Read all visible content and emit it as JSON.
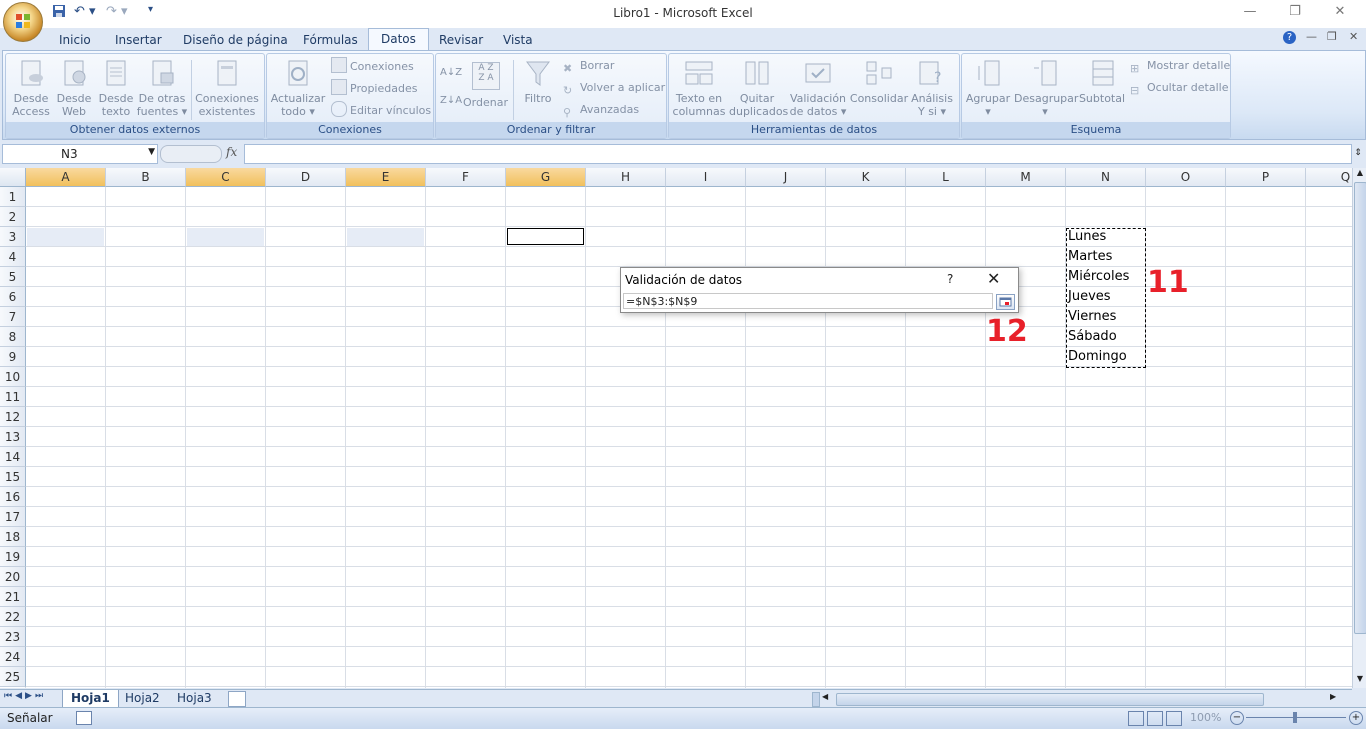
{
  "window": {
    "title": "Libro1 - Microsoft Excel",
    "controls": {
      "minimize": "—",
      "restore": "❐",
      "close": "✕"
    }
  },
  "tabs": [
    "Inicio",
    "Insertar",
    "Diseño de página",
    "Fórmulas",
    "Datos",
    "Revisar",
    "Vista"
  ],
  "active_tab": "Datos",
  "ribbon": {
    "groups": {
      "external": {
        "label": "Obtener datos externos",
        "buttons": [
          {
            "line1": "Desde",
            "line2": "Access"
          },
          {
            "line1": "Desde",
            "line2": "Web"
          },
          {
            "line1": "Desde",
            "line2": "texto"
          },
          {
            "line1": "De otras",
            "line2": "fuentes ▾"
          },
          {
            "line1": "Conexiones",
            "line2": "existentes"
          }
        ]
      },
      "connections": {
        "label": "Conexiones",
        "refresh": {
          "line1": "Actualizar",
          "line2": "todo ▾"
        },
        "items": [
          "Conexiones",
          "Propiedades",
          "Editar vínculos"
        ]
      },
      "sort": {
        "label": "Ordenar y filtrar",
        "sort_btn": "Ordenar",
        "filter_btn": "Filtro",
        "items": [
          "Borrar",
          "Volver a aplicar",
          "Avanzadas"
        ]
      },
      "tools": {
        "label": "Herramientas de datos",
        "buttons": [
          {
            "line1": "Texto en",
            "line2": "columnas"
          },
          {
            "line1": "Quitar",
            "line2": "duplicados"
          },
          {
            "line1": "Validación",
            "line2": "de datos ▾"
          },
          {
            "line1": "Consolidar",
            "line2": ""
          },
          {
            "line1": "Análisis",
            "line2": "Y si ▾"
          }
        ]
      },
      "outline": {
        "label": "Esquema",
        "buttons": [
          {
            "line1": "Agrupar",
            "line2": "▾"
          },
          {
            "line1": "Desagrupar",
            "line2": "▾"
          },
          {
            "line1": "Subtotal",
            "line2": ""
          }
        ],
        "items": [
          "Mostrar detalle",
          "Ocultar detalle"
        ]
      }
    }
  },
  "formula_bar": {
    "name_box": "N3",
    "fx": "fx",
    "value": ""
  },
  "columns": [
    "A",
    "B",
    "C",
    "D",
    "E",
    "F",
    "G",
    "H",
    "I",
    "J",
    "K",
    "L",
    "M",
    "N",
    "O",
    "P",
    "Q"
  ],
  "highlight_columns": [
    "A",
    "C",
    "E",
    "G"
  ],
  "rows": [
    "1",
    "2",
    "3",
    "4",
    "5",
    "6",
    "7",
    "8",
    "9",
    "10",
    "11",
    "12",
    "13",
    "14",
    "15",
    "16",
    "17",
    "18",
    "19",
    "20",
    "21",
    "22",
    "23",
    "24",
    "25"
  ],
  "list_values": [
    "Lunes",
    "Martes",
    "Miércoles",
    "Jueves",
    "Viernes",
    "Sábado",
    "Domingo"
  ],
  "dialog": {
    "title": "Validación de datos",
    "help": "?",
    "close": "✕",
    "input_value": "=$N$3:$N$9"
  },
  "annotations": {
    "a11": "11",
    "a12": "12"
  },
  "sheets": [
    "Hoja1",
    "Hoja2",
    "Hoja3"
  ],
  "active_sheet": "Hoja1",
  "status": {
    "mode": "Señalar",
    "zoom": "100%"
  }
}
